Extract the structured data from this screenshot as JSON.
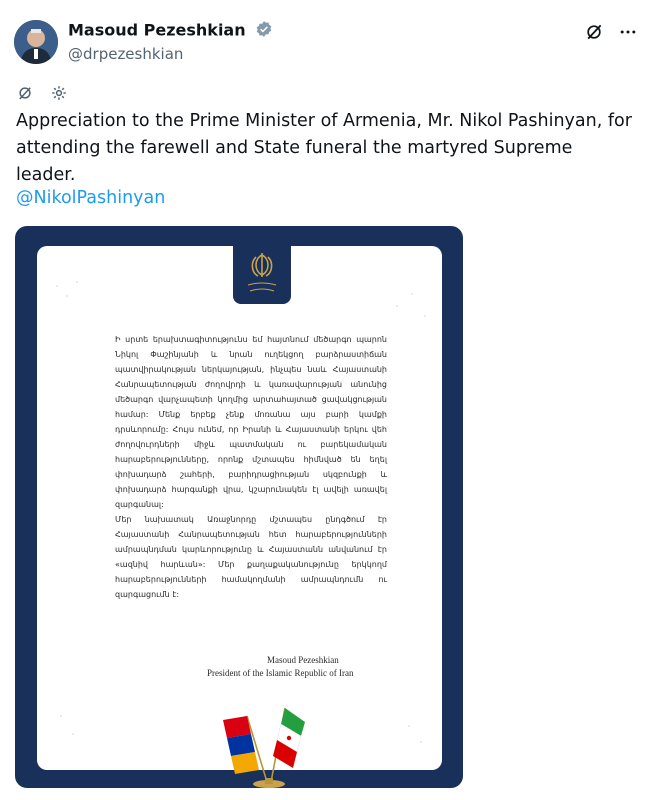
{
  "author": {
    "name": "Masoud Pezeshkian",
    "handle": "@drpezeshkian",
    "verified": true
  },
  "icons": {
    "grok": "grok-icon",
    "more": "more-icon",
    "translate": "translate-icon",
    "settings": "settings-icon"
  },
  "tweet": {
    "text": "Appreciation to the Prime Minister of Armenia, Mr. Nikol Pashinyan, for attending the farewell and State funeral the martyred Supreme leader.",
    "mention": "@NikolPashinyan"
  },
  "letter": {
    "body": "Ի սրտե երախտագիտությունս եմ հայտնում մեծարգո պարոն Նիկոլ Փաշինյանի և նրան ուղեկցող բարձրաստիճան պատվիրակության ներկայության, ինչպես նաև Հայաստանի Հանրապետության ժողովրդի և կառավարության անունից մեծարգո վարչապետի կողմից արտահայտած ցավակցության համար: Մենք երբեք չենք մոռանա այս բարի կամքի դրսևորումը: Հույս ունեմ, որ Իրանի և Հայաստանի երկու վեհ ժողովուրդների միջև պատմական ու բարեկամական հարաբերությունները, որոնք մշտապես հիմնված են եղել փոխադարձ շահերի, բարիդրացիության սկզբունքի և փոխադարձ հարգանքի վրա, կշարունակեն էլ ավելի առավել զարգանալ:\nՄեր նախատակ Առաջնորդը մշտապես ընդգծում էր Հայաստանի Հանրապետության հետ հարաբերությունների ամրապնդման կարևորությունը և Հայաստանն անվանում էր «ազնիվ հարևան»: Մեր քաղաքականությունը երկկողմ հարաբերությունների համակողմանի ամրապնդումն ու զարգացումն է:",
    "signature_name": "Masoud Pezeshkian",
    "signature_title": "President of the Islamic Republic of Iran"
  },
  "colors": {
    "accent": "#1d9bf0",
    "frame": "#18305a",
    "text": "#0f1419",
    "muted": "#536471"
  }
}
